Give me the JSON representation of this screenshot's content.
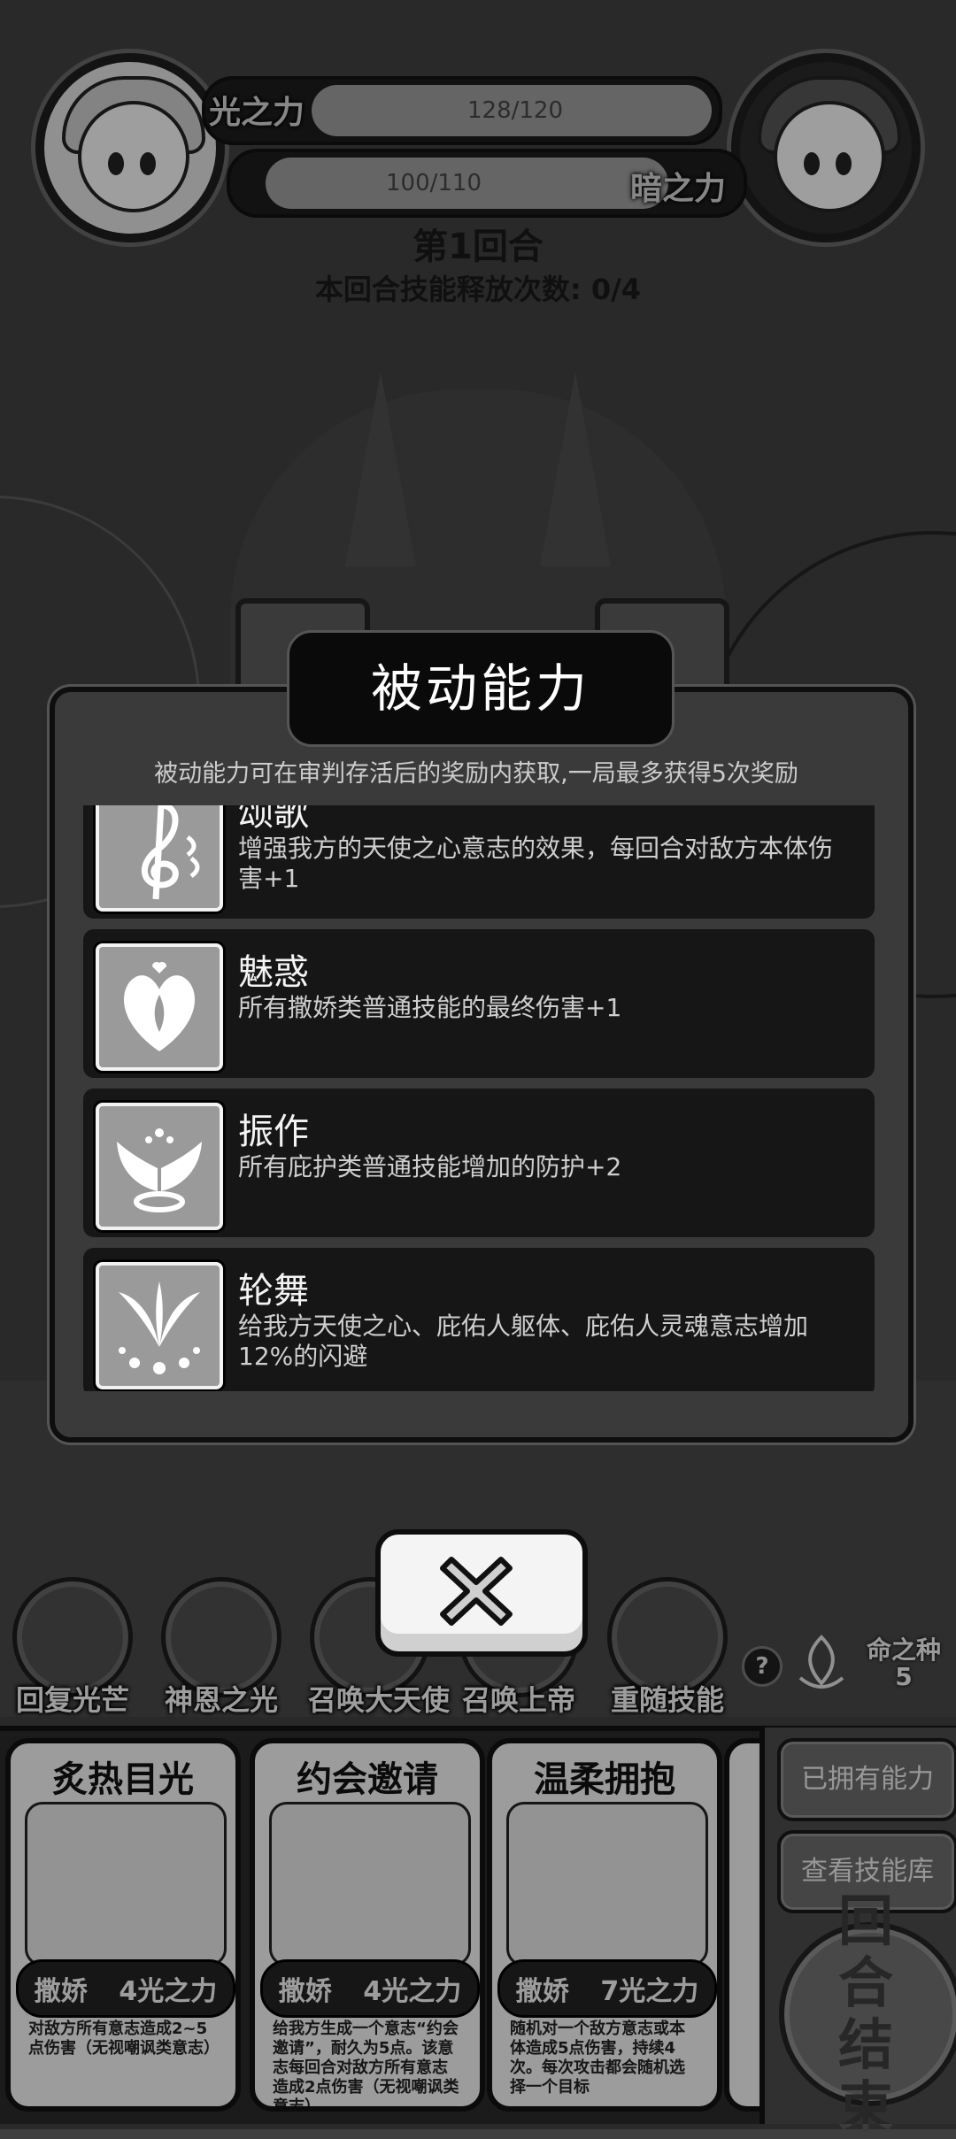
{
  "hud": {
    "light_label": "光之力",
    "light_value": "128/120",
    "light_fill": 1.0,
    "dark_label": "暗之力",
    "dark_value": "100/110",
    "dark_fill": 0.91,
    "round_title": "第1回合",
    "round_sub": "本回合技能释放次数: 0/4"
  },
  "modal": {
    "title": "被动能力",
    "subtitle": "被动能力可在审判存活后的奖励内获取,一局最多获得5次奖励",
    "items": [
      {
        "name": "颂歌",
        "desc": "增强我方的天使之心意志的效果，每回合对敌方本体伤害+1",
        "icon": "treble-clef-icon"
      },
      {
        "name": "魅惑",
        "desc": "所有撒娇类普通技能的最终伤害+1",
        "icon": "winged-heart-icon"
      },
      {
        "name": "振作",
        "desc": "所有庇护类普通技能增加的防护+2",
        "icon": "wings-halo-icon"
      },
      {
        "name": "轮舞",
        "desc": "给我方天使之心、庇佑人躯体、庇佑人灵魂意志增加12%的闪避",
        "icon": "feather-burst-icon"
      }
    ],
    "close_icon": "close-x-icon"
  },
  "skills": [
    {
      "label": "回复光芒"
    },
    {
      "label": "神恩之光"
    },
    {
      "label": "召唤大天使"
    },
    {
      "label": "召唤上帝"
    },
    {
      "label": "重随技能"
    }
  ],
  "seed": {
    "help": "?",
    "label": "命之种",
    "count": "5"
  },
  "cards": [
    {
      "title": "炙热目光",
      "type": "撒娇",
      "cost": "4光之力",
      "desc": "对敌方所有意志造成2~5点伤害（无视嘲讽类意志）"
    },
    {
      "title": "约会邀请",
      "type": "撒娇",
      "cost": "4光之力",
      "desc": "给我方生成一个意志“约会邀请”，耐久为5点。该意志每回合对敌方所有意志造成2点伤害（无视嘲讽类意志）"
    },
    {
      "title": "温柔拥抱",
      "type": "撒娇",
      "cost": "7光之力",
      "desc": "随机对一个敌方意志或本体造成5点伤害，持续4次。每次攻击都会随机选择一个目标"
    }
  ],
  "side": {
    "owned": "已拥有能力",
    "library": "查看技能库",
    "end_line1": "回合",
    "end_line2": "结束"
  }
}
